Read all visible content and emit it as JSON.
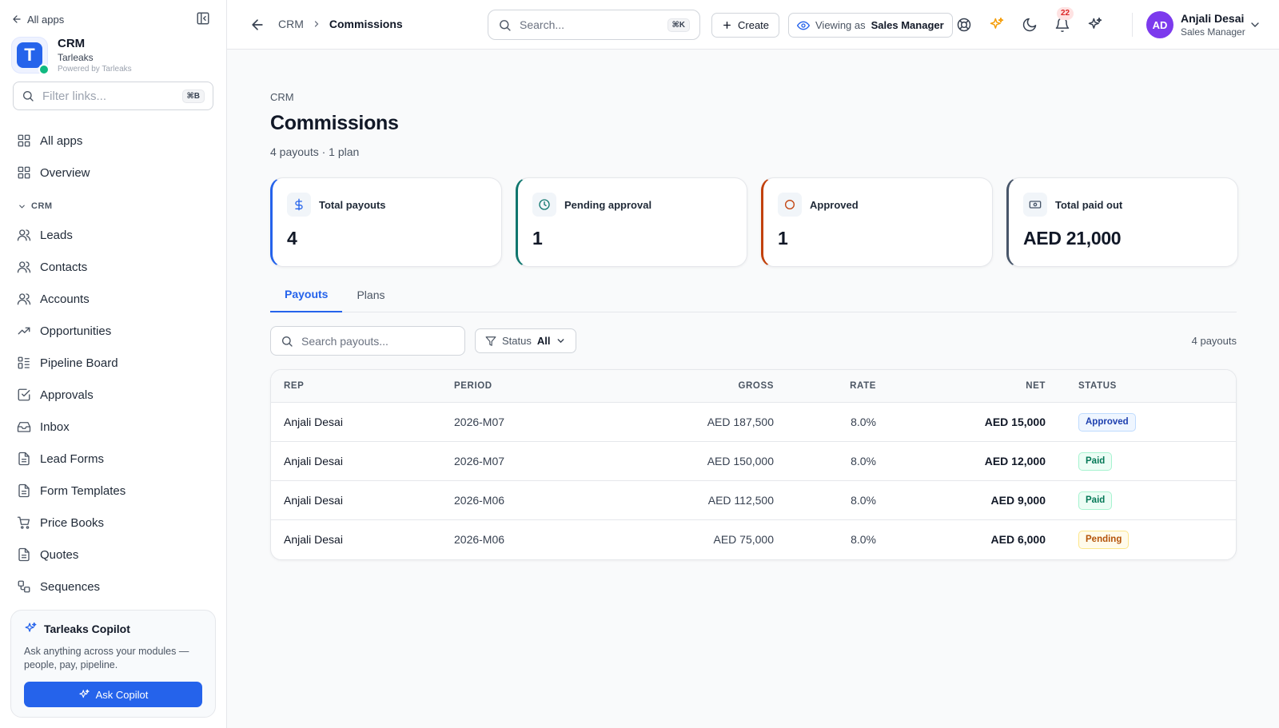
{
  "sidebar": {
    "all_apps_link": "All apps",
    "brand": {
      "name": "CRM",
      "org": "Tarleaks",
      "powered": "Powered by Tarleaks",
      "logo_letter": "T"
    },
    "filter": {
      "placeholder": "Filter links...",
      "shortcut": "⌘B"
    },
    "top_items": [
      {
        "label": "All apps",
        "icon": "grid-icon"
      },
      {
        "label": "Overview",
        "icon": "grid-icon"
      }
    ],
    "section_label": "CRM",
    "items": [
      {
        "label": "Leads",
        "icon": "users-icon"
      },
      {
        "label": "Contacts",
        "icon": "users-icon"
      },
      {
        "label": "Accounts",
        "icon": "users-icon"
      },
      {
        "label": "Opportunities",
        "icon": "trending-up-icon"
      },
      {
        "label": "Pipeline Board",
        "icon": "kanban-icon"
      },
      {
        "label": "Approvals",
        "icon": "check-square-icon"
      },
      {
        "label": "Inbox",
        "icon": "inbox-icon"
      },
      {
        "label": "Lead Forms",
        "icon": "file-icon"
      },
      {
        "label": "Form Templates",
        "icon": "file-icon"
      },
      {
        "label": "Price Books",
        "icon": "cart-icon"
      },
      {
        "label": "Quotes",
        "icon": "file-icon"
      },
      {
        "label": "Sequences",
        "icon": "sequence-icon"
      }
    ],
    "copilot": {
      "title": "Tarleaks Copilot",
      "description": "Ask anything across your modules — people, pay, pipeline.",
      "button": "Ask Copilot"
    }
  },
  "header": {
    "breadcrumb": [
      "CRM",
      "Commissions"
    ],
    "search": {
      "placeholder": "Search...",
      "shortcut": "⌘K"
    },
    "create_label": "Create",
    "viewing": {
      "prefix": "Viewing as",
      "role": "Sales Manager"
    },
    "notifications_count": "22",
    "user": {
      "initials": "AD",
      "name": "Anjali Desai",
      "role": "Sales Manager"
    }
  },
  "page": {
    "crumb": "CRM",
    "title": "Commissions",
    "subtitle": "4 payouts · 1 plan"
  },
  "stats": [
    {
      "label": "Total payouts",
      "value": "4",
      "icon": "dollar-icon",
      "accent": "#2563eb"
    },
    {
      "label": "Pending approval",
      "value": "1",
      "icon": "clock-icon",
      "accent": "#0f766e"
    },
    {
      "label": "Approved",
      "value": "1",
      "icon": "circle-icon",
      "accent": "#c2410c"
    },
    {
      "label": "Total paid out",
      "value": "AED 21,000",
      "icon": "banknote-icon",
      "accent": "#475569"
    }
  ],
  "tabs": [
    {
      "label": "Payouts",
      "active": true
    },
    {
      "label": "Plans",
      "active": false
    }
  ],
  "payouts": {
    "search_placeholder": "Search payouts...",
    "status_filter": {
      "label": "Status",
      "value": "All"
    },
    "count_label": "4 payouts",
    "columns": {
      "rep": "REP",
      "period": "PERIOD",
      "gross": "GROSS",
      "rate": "RATE",
      "net": "NET",
      "status": "STATUS"
    },
    "rows": [
      {
        "rep": "Anjali Desai",
        "period": "2026-M07",
        "gross": "AED 187,500",
        "rate": "8.0%",
        "net": "AED 15,000",
        "status": "Approved",
        "status_kind": "approved"
      },
      {
        "rep": "Anjali Desai",
        "period": "2026-M07",
        "gross": "AED 150,000",
        "rate": "8.0%",
        "net": "AED 12,000",
        "status": "Paid",
        "status_kind": "paid"
      },
      {
        "rep": "Anjali Desai",
        "period": "2026-M06",
        "gross": "AED 112,500",
        "rate": "8.0%",
        "net": "AED 9,000",
        "status": "Paid",
        "status_kind": "paid"
      },
      {
        "rep": "Anjali Desai",
        "period": "2026-M06",
        "gross": "AED 75,000",
        "rate": "8.0%",
        "net": "AED 6,000",
        "status": "Pending",
        "status_kind": "pending"
      }
    ]
  }
}
